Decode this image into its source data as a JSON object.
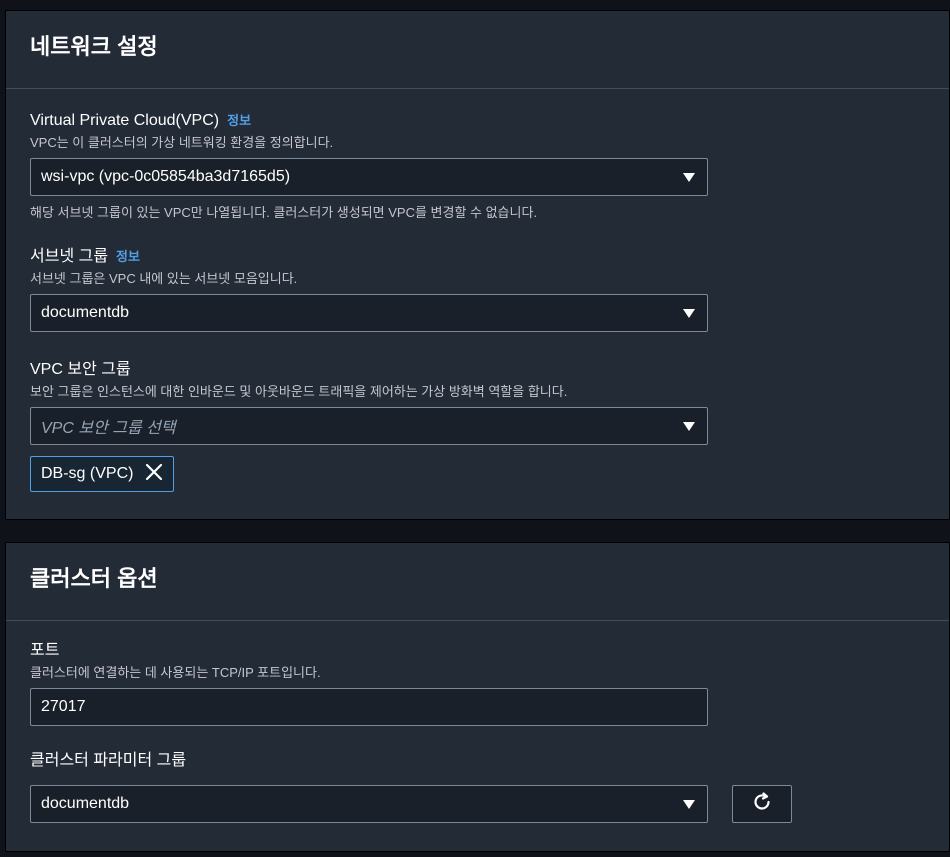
{
  "network": {
    "title": "네트워크 설정",
    "info_label": "정보",
    "vpc": {
      "label": "Virtual Private Cloud(VPC)",
      "description": "VPC는 이 클러스터의 가상 네트워킹 환경을 정의합니다.",
      "value": "wsi-vpc (vpc-0c05854ba3d7165d5)",
      "hint": "해당 서브넷 그룹이 있는 VPC만 나열됩니다. 클러스터가 생성되면 VPC를 변경할 수 없습니다."
    },
    "subnet": {
      "label": "서브넷 그룹",
      "description": "서브넷 그룹은 VPC 내에 있는 서브넷 모음입니다.",
      "value": "documentdb"
    },
    "security": {
      "label": "VPC 보안 그룹",
      "description": "보안 그룹은 인스턴스에 대한 인바운드 및 아웃바운드 트래픽을 제어하는 가상 방화벽 역할을 합니다.",
      "placeholder": "VPC 보안 그룹 선택",
      "selected_token": "DB-sg (VPC)"
    }
  },
  "cluster": {
    "title": "클러스터 옵션",
    "port": {
      "label": "포트",
      "description": "클러스터에 연결하는 데 사용되는 TCP/IP 포트입니다.",
      "value": "27017"
    },
    "parameter_group": {
      "label": "클러스터 파라미터 그룹",
      "value": "documentdb"
    }
  },
  "icons": {
    "caret": "caret-down-icon",
    "remove": "close-icon",
    "refresh": "refresh-icon"
  }
}
